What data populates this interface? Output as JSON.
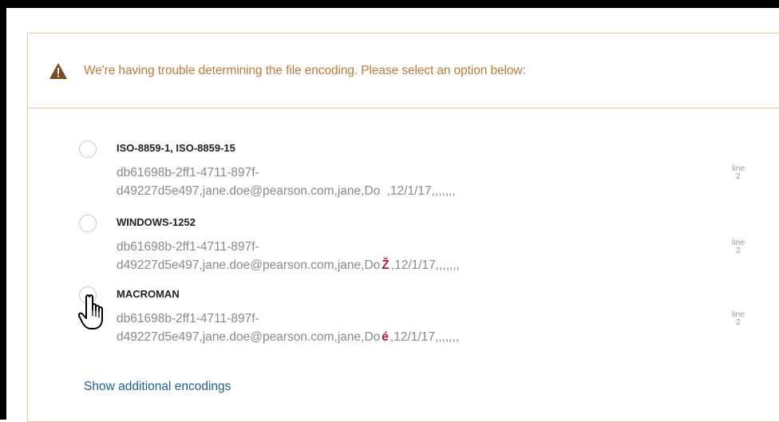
{
  "warning": {
    "icon": "warning-triangle-icon",
    "message": "We're having trouble determining the file encoding. Please select an option below:"
  },
  "options": [
    {
      "label": "ISO-8859-1, ISO-8859-15",
      "sample_line1": "db61698b-2ff1-4711-897f-",
      "sample_prefix": "d49227d5e497,jane.doe@pearson.com,jane,Do ",
      "sample_char": "",
      "sample_suffix": ",12/1/17,,,,,,,",
      "line_label": "line",
      "line_number": "2",
      "selected": false
    },
    {
      "label": "WINDOWS-1252",
      "sample_line1": "db61698b-2ff1-4711-897f-",
      "sample_prefix": "d49227d5e497,jane.doe@pearson.com,jane,Do",
      "sample_char": "Ž",
      "sample_suffix": ",12/1/17,,,,,,,",
      "line_label": "line",
      "line_number": "2",
      "selected": false
    },
    {
      "label": "MACROMAN",
      "sample_line1": "db61698b-2ff1-4711-897f-",
      "sample_prefix": "d49227d5e497,jane.doe@pearson.com,jane,Do",
      "sample_char": "é",
      "sample_suffix": ",12/1/17,,,,,,,",
      "line_label": "line",
      "line_number": "2",
      "selected": false
    }
  ],
  "show_more_label": "Show additional encodings",
  "colors": {
    "warning_text": "#c07a3c",
    "highlight_char": "#b01e2a",
    "link": "#1f6296",
    "border": "#e6c6a8"
  }
}
